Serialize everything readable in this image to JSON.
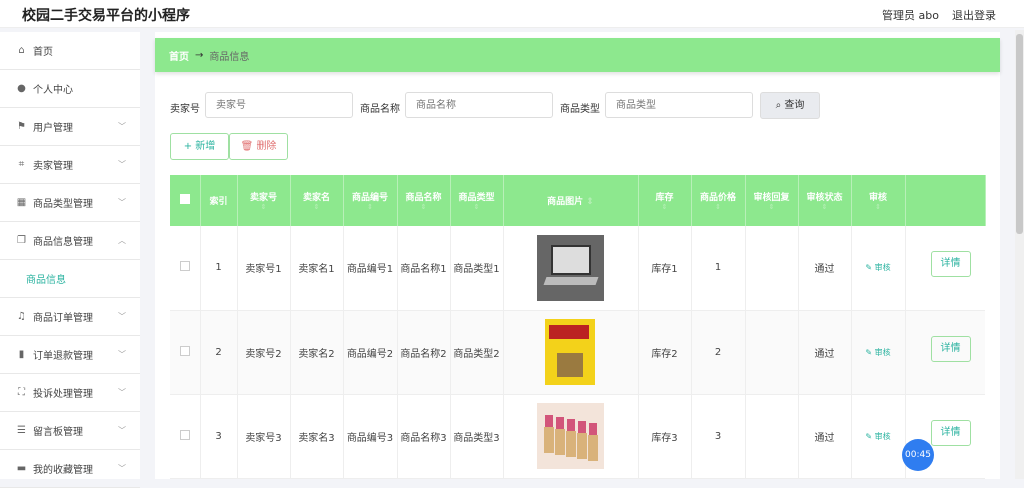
{
  "header": {
    "title": "校园二手交易平台的小程序",
    "admin": "管理员 abo",
    "logout": "退出登录"
  },
  "sidebar": {
    "items": [
      {
        "label": "首页",
        "icon": "home-icon"
      },
      {
        "label": "个人中心",
        "icon": "user-icon"
      },
      {
        "label": "用户管理",
        "icon": "flag-icon",
        "chevron": "down"
      },
      {
        "label": "卖家管理",
        "icon": "crop-icon",
        "chevron": "down"
      },
      {
        "label": "商品类型管理",
        "icon": "chart-icon",
        "chevron": "down"
      },
      {
        "label": "商品信息管理",
        "icon": "copy-icon",
        "chevron": "up"
      },
      {
        "label": "商品订单管理",
        "icon": "bell-icon",
        "chevron": "down"
      },
      {
        "label": "订单退款管理",
        "icon": "trash-icon",
        "chevron": "down"
      },
      {
        "label": "投诉处理管理",
        "icon": "fullscreen-icon",
        "chevron": "down"
      },
      {
        "label": "留言板管理",
        "icon": "sliders-icon",
        "chevron": "down"
      },
      {
        "label": "我的收藏管理",
        "icon": "monitor-icon",
        "chevron": "down"
      }
    ],
    "sub_active": "商品信息"
  },
  "breadcrumb": {
    "home": "首页",
    "arrow": "→",
    "current": "商品信息"
  },
  "search": {
    "seller_label": "卖家号",
    "seller_placeholder": "卖家号",
    "name_label": "商品名称",
    "name_placeholder": "商品名称",
    "type_label": "商品类型",
    "type_placeholder": "商品类型",
    "query": "查询"
  },
  "actions": {
    "add": "新增",
    "delete": "删除"
  },
  "table": {
    "columns": [
      "索引",
      "卖家号",
      "卖家名",
      "商品编号",
      "商品名称",
      "商品类型",
      "商品图片",
      "库存",
      "商品价格",
      "审核回复",
      "审核状态",
      "审核"
    ],
    "rows": [
      {
        "idx": "1",
        "seller_no": "卖家号1",
        "seller_name": "卖家名1",
        "code": "商品编号1",
        "name": "商品名称1",
        "type": "商品类型1",
        "image": "laptop",
        "stock": "库存1",
        "price": "1",
        "reply": "",
        "status": "通过",
        "audit": "审核",
        "detail": "详情"
      },
      {
        "idx": "2",
        "seller_no": "卖家号2",
        "seller_name": "卖家名2",
        "code": "商品编号2",
        "name": "商品名称2",
        "type": "商品类型2",
        "image": "book",
        "stock": "库存2",
        "price": "2",
        "reply": "",
        "status": "通过",
        "audit": "审核",
        "detail": "详情"
      },
      {
        "idx": "3",
        "seller_no": "卖家号3",
        "seller_name": "卖家名3",
        "code": "商品编号3",
        "name": "商品名称3",
        "type": "商品类型3",
        "image": "lipstick",
        "stock": "库存3",
        "price": "3",
        "reply": "",
        "status": "通过",
        "audit": "审核",
        "detail": "详情"
      }
    ]
  },
  "timer": "00:45",
  "colors": {
    "accent": "#8de88e",
    "teal": "#2bb3a0",
    "danger": "#e07070"
  }
}
